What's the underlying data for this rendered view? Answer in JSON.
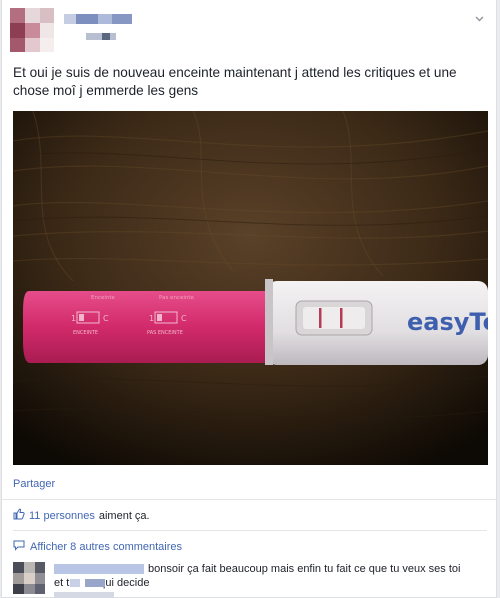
{
  "post": {
    "text": "Et oui je suis de nouveau enceinte maintenant j attend les critiques et une chose moî j emmerde les gens",
    "test_brand": "easyTe",
    "test_left_label": "Enceinte",
    "test_right_label": "Pas enceinte",
    "test_pregnant": "ENCEINTE",
    "test_not_pregnant": "PAS ENCEINTE",
    "share_label": "Partager",
    "likes_count": "11 personnes",
    "likes_suffix": "aiment ça.",
    "more_comments": "Afficher 8 autres commentaires"
  },
  "comment": {
    "text_part1": "bonsoir ça fait beaucoup mais enfin tu fait ce que tu veux ses toi",
    "text_part2_a": "et t",
    "text_part2_b": "qui decide"
  },
  "colors": {
    "link": "#4267b2",
    "test_pink": "#d8306f",
    "text": "#1d2129"
  },
  "icons": [
    "chevron-down-icon",
    "thumbs-up-icon",
    "comment-icon"
  ]
}
